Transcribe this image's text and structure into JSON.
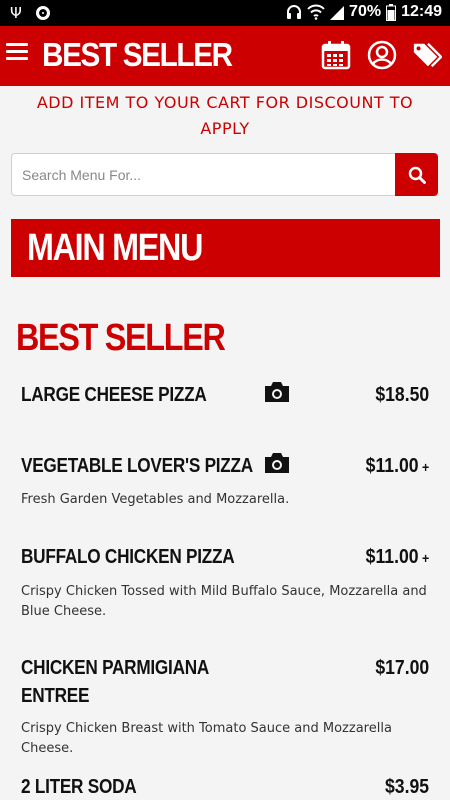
{
  "status_bar": {
    "icons": [
      "usb-icon",
      "record-icon",
      "headset-icon",
      "wifi-icon",
      "cell-signal-icon",
      "battery-icon"
    ],
    "battery": "70%",
    "time": "12:49"
  },
  "app_bar": {
    "title": "BEST SELLER",
    "icons": [
      "menu-icon",
      "calendar-icon",
      "user-icon",
      "tags-icon"
    ]
  },
  "promo": {
    "text": "ADD ITEM TO YOUR CART FOR DISCOUNT TO APPLY"
  },
  "search": {
    "placeholder": "Search Menu For...",
    "value": ""
  },
  "main_menu": {
    "label": "MAIN MENU"
  },
  "category": {
    "title": "BEST SELLER",
    "items": [
      {
        "name": "LARGE CHEESE PIZZA",
        "price": "$18.50",
        "plus": "",
        "description": "",
        "camera": true
      },
      {
        "name": "VEGETABLE LOVER'S PIZZA",
        "price": "$11.00",
        "plus": "+",
        "description": "Fresh Garden Vegetables and Mozzarella.",
        "camera": true
      },
      {
        "name": "BUFFALO CHICKEN PIZZA",
        "price": "$11.00",
        "plus": "+",
        "description": "Crispy Chicken Tossed with Mild Buffalo Sauce, Mozzarella and Blue Cheese.",
        "camera": false
      },
      {
        "name": "CHICKEN PARMIGIANA ENTREE",
        "price": "$17.00",
        "plus": "",
        "description": "Crispy Chicken Breast with Tomato Sauce and Mozzarella Cheese.",
        "camera": false
      },
      {
        "name": "2 LITER SODA",
        "price": "$3.95",
        "plus": "",
        "description": "",
        "camera": false
      }
    ]
  },
  "colors": {
    "brand_red": "#cc0000",
    "background": "#f4f4f4",
    "status_bar": "#000000"
  }
}
